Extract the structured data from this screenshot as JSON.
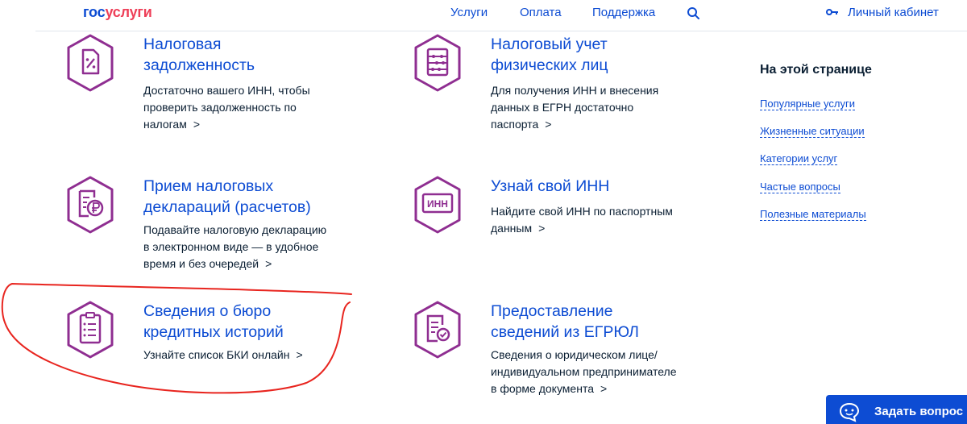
{
  "header": {
    "logo_part1": "гос",
    "logo_part2": "услуги",
    "nav": [
      "Услуги",
      "Оплата",
      "Поддержка"
    ],
    "cabinet_label": "Личный кабинет"
  },
  "cards": [
    {
      "title_lines": [
        "Налоговая",
        "задолженность"
      ],
      "desc_lines": [
        "Достаточно вашего ИНН, чтобы",
        "проверить задолженность по",
        "налогам"
      ],
      "icon": "percent-document-icon"
    },
    {
      "title_lines": [
        "Налоговый учет",
        "физических лиц"
      ],
      "desc_lines": [
        "Для получения ИНН и внесения",
        "данных в ЕГРН достаточно",
        "паспорта"
      ],
      "icon": "abacus-icon"
    },
    {
      "title_lines": [
        "Прием налоговых",
        "деклараций (расчетов)"
      ],
      "desc_lines": [
        "Подавайте налоговую декларацию",
        "в электронном виде — в удобное",
        "время и без очередей"
      ],
      "icon": "ruble-document-icon"
    },
    {
      "title_lines": [
        "Узнай свой ИНН"
      ],
      "desc_lines": [
        "Найдите свой ИНН по паспортным",
        "данным"
      ],
      "icon": "inn-card-icon",
      "icon_text": "ИНН"
    },
    {
      "title_lines": [
        "Сведения о бюро",
        "кредитных историй"
      ],
      "desc_lines": [
        "Узнайте список БКИ онлайн"
      ],
      "icon": "clipboard-list-icon"
    },
    {
      "title_lines": [
        "Предоставление",
        "сведений из ЕГРЮЛ"
      ],
      "desc_lines": [
        "Сведения о юридическом лице/",
        "индивидуальном предпринимателе",
        "в форме документа"
      ],
      "icon": "document-check-icon"
    }
  ],
  "chevron": ">",
  "sidebar": {
    "title": "На этой странице",
    "links": [
      "Популярные услуги",
      "Жизненные ситуации",
      "Категории услуг",
      "Частые вопросы",
      "Полезные материалы"
    ]
  },
  "ask_button": {
    "label": "Задать вопрос"
  },
  "colors": {
    "brand_blue": "#0d4cd3",
    "brand_red": "#ee3f58",
    "icon_purple": "#8f2e91",
    "annotation_red": "#e8251f"
  }
}
